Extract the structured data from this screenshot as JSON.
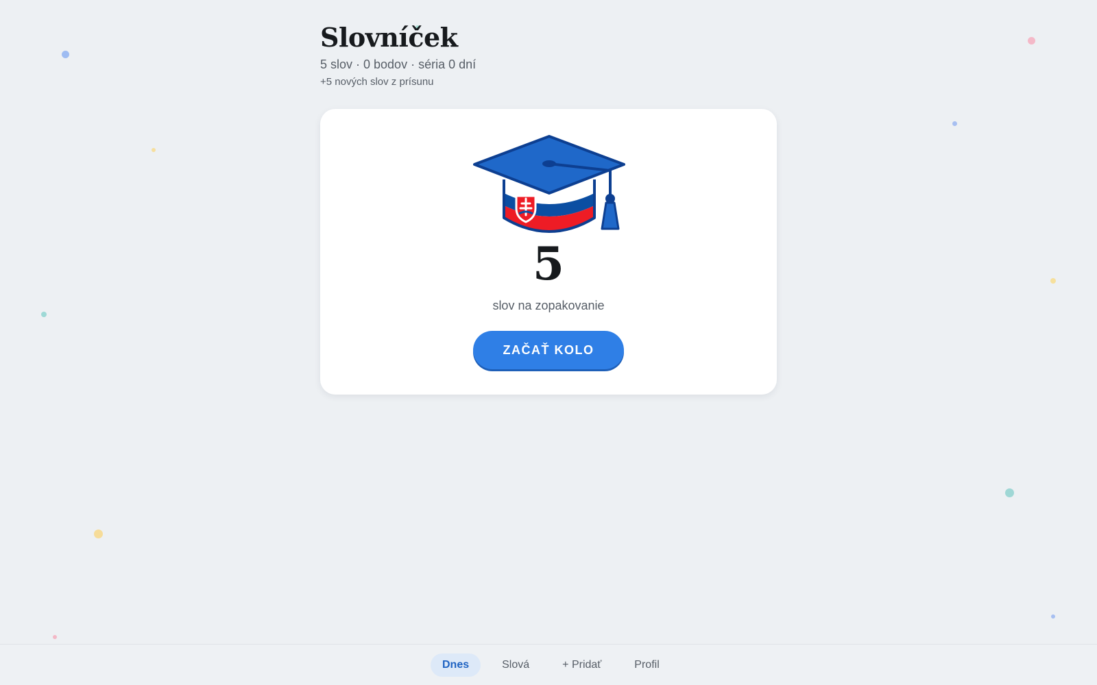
{
  "app": {
    "title": "Slovníček",
    "stats": "5 slov · 0 bodov · séria 0 dní",
    "new_words": "+5 nových slov z prísunu"
  },
  "review_card": {
    "icon": "graduation-cap-icon",
    "count": "5",
    "count_label": "slov na zopakovanie",
    "start_label": "ZAČAŤ KOLO"
  },
  "nav": {
    "items": [
      {
        "label": "Dnes",
        "active": true
      },
      {
        "label": "Slová",
        "active": false
      },
      {
        "label": "+ Pridať",
        "active": false
      },
      {
        "label": "Profil",
        "active": false
      }
    ]
  },
  "colors": {
    "background": "#edf0f3",
    "accent": "#2f7fe6",
    "flag_white": "#ffffff",
    "flag_blue": "#0b4ea2",
    "flag_red": "#ee1c25"
  }
}
